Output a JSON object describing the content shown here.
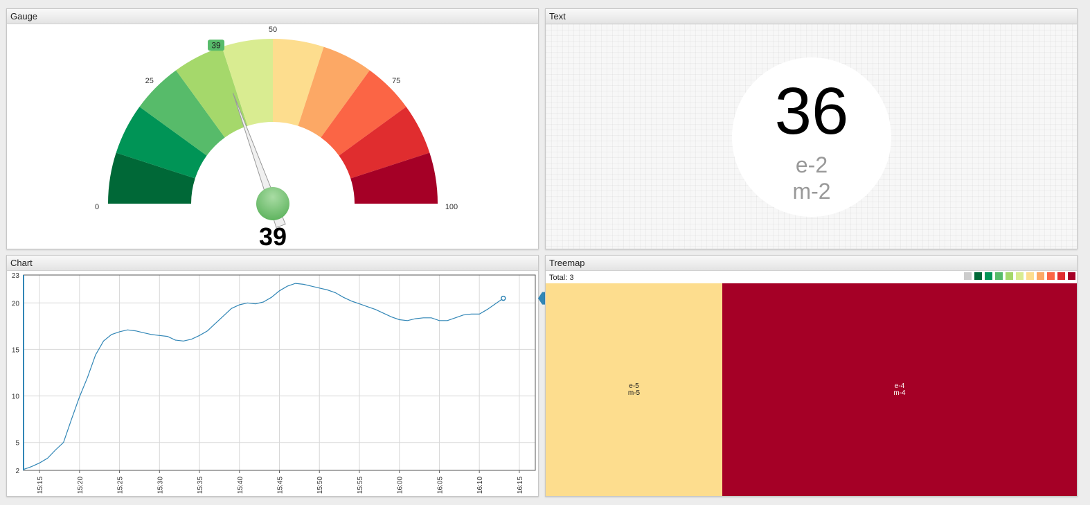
{
  "gauge": {
    "title": "Gauge",
    "value": 39,
    "min": 0,
    "max": 100,
    "tick_labels": [
      "0",
      "25",
      "50",
      "75",
      "100"
    ],
    "value_label": "39",
    "bubble_label": "39",
    "band_colors": [
      "#006837",
      "#009456",
      "#57bb6a",
      "#a5d86b",
      "#d9ec91",
      "#fddd8e",
      "#fca865",
      "#fb6545",
      "#e02d2f",
      "#a50026"
    ],
    "needle_color": "#5fb45f"
  },
  "text_widget": {
    "title": "Text",
    "value": "36",
    "line1": "e-2",
    "line2": "m-2"
  },
  "chart": {
    "title": "Chart",
    "last_value_label": "20.5"
  },
  "chart_data": {
    "type": "line",
    "y_ticks": [
      "2",
      "5",
      "10",
      "15",
      "20",
      "23"
    ],
    "ylim": [
      2,
      23
    ],
    "x_ticks": [
      "15:15",
      "15:20",
      "15:25",
      "15:30",
      "15:35",
      "15:40",
      "15:45",
      "15:50",
      "15:55",
      "16:00",
      "16:05",
      "16:10",
      "16:15"
    ],
    "xlim": [
      "15:13",
      "16:17"
    ],
    "grid": true,
    "series": [
      {
        "color": "#3186b6",
        "x": [
          "15:13",
          "15:14",
          "15:15",
          "15:16",
          "15:17",
          "15:18",
          "15:19",
          "15:20",
          "15:21",
          "15:22",
          "15:23",
          "15:24",
          "15:25",
          "15:26",
          "15:27",
          "15:28",
          "15:29",
          "15:30",
          "15:31",
          "15:32",
          "15:33",
          "15:34",
          "15:35",
          "15:36",
          "15:37",
          "15:38",
          "15:39",
          "15:40",
          "15:41",
          "15:42",
          "15:43",
          "15:44",
          "15:45",
          "15:46",
          "15:47",
          "15:48",
          "15:49",
          "15:50",
          "15:51",
          "15:52",
          "15:53",
          "15:54",
          "15:55",
          "15:56",
          "15:57",
          "15:58",
          "15:59",
          "16:00",
          "16:01",
          "16:02",
          "16:03",
          "16:04",
          "16:05",
          "16:06",
          "16:07",
          "16:08",
          "16:09",
          "16:10",
          "16:11",
          "16:12",
          "16:13"
        ],
        "y": [
          2.1,
          2.4,
          2.8,
          3.3,
          4.2,
          5.0,
          7.5,
          9.9,
          12.0,
          14.4,
          15.9,
          16.6,
          16.9,
          17.1,
          17.0,
          16.8,
          16.6,
          16.5,
          16.4,
          16.0,
          15.9,
          16.1,
          16.5,
          17.0,
          17.8,
          18.6,
          19.4,
          19.8,
          20.0,
          19.9,
          20.1,
          20.6,
          21.3,
          21.8,
          22.1,
          22.0,
          21.8,
          21.6,
          21.4,
          21.1,
          20.6,
          20.2,
          19.9,
          19.6,
          19.3,
          18.9,
          18.5,
          18.2,
          18.1,
          18.3,
          18.4,
          18.4,
          18.1,
          18.1,
          18.4,
          18.7,
          18.8,
          18.8,
          19.3,
          19.9,
          20.5
        ]
      }
    ]
  },
  "treemap": {
    "title": "Treemap",
    "total_label": "Total: 3",
    "legend_colors": [
      "#cccccc",
      "#006837",
      "#009456",
      "#57bb6a",
      "#a5d86b",
      "#d9ec91",
      "#fddd8e",
      "#fca865",
      "#fb6545",
      "#e02d2f",
      "#a50026"
    ],
    "cells": [
      {
        "line1": "e-5",
        "line2": "m-5",
        "color": "#fddd8e",
        "share": 0.333,
        "text_color": "#222222"
      },
      {
        "line1": "e-4",
        "line2": "m-4",
        "color": "#a50026",
        "share": 0.667,
        "text_color": "#ffffff"
      }
    ]
  }
}
